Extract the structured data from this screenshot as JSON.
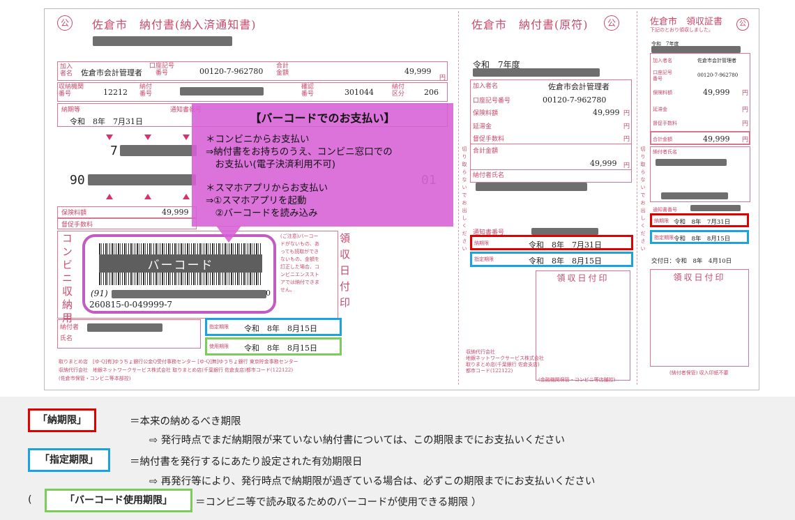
{
  "left_slip": {
    "title": "佐倉市　納付書(納入済通知書)",
    "logo_char": "公",
    "kanyusha_label": "加入者名",
    "kanyusha_name": "佐倉市会計管理者",
    "koza_label": "口座記号番号",
    "koza_no": "00120-7-962780",
    "gokei_label": "合計金額",
    "gokei_amount": "49,999",
    "yen": "円",
    "shuno_label": "収納機関番号",
    "shuno_no": "12212",
    "nofu_no_label": "納付番号",
    "kakunin_label": "確認番号",
    "kakunin_no": "301044",
    "nofu_kubun_label": "納付区分",
    "nofu_kubun": "206",
    "nokigen_label": "納期等",
    "nokigen_value": "令和　8年　7月31日",
    "tsuchisho_label": "通知書番号",
    "barcode_line1_prefix": "7",
    "barcode_line2_prefix": "90",
    "barcode_line2_suffix": "01",
    "hokenryo_label": "保険料額",
    "hokenryo_amount": "49,999",
    "tokusoku_label": "督促手数料",
    "conv_vertical": "コンビニ収納用",
    "barcode_text": "バーコード",
    "barcode_prefix": "(91)",
    "barcode_bottom": "260815-0-049999-7",
    "note_text": "(ご注意)バーコードがないもの、あっても読取ができないもの、金額を訂正した場合、コンビニエンスストアでは納付できません。",
    "ryoshu_vertical": "領収日付印",
    "shitei_label": "指定期限",
    "shitei_value": "令和　8年　8月15日",
    "shiyou_label": "使用期限",
    "shiyou_value": "令和　8年　8月15日",
    "nofusha_label": "納付者氏名",
    "footer1": "取りまとめ店　[ゆ-Q]有]ゆうちょ銀行公金Q受付事務センター [ゆ-Q]無]ゆうちょ銀行 東京貯金事務センター",
    "footer2": "収納代行会社　地銀ネットワークサービス株式会社 取りまとめ店(千葉銀行 佐倉支店)都市コード(122122)",
    "footer3": "(佐倉市保管・コンビニ等本部控)"
  },
  "popup": {
    "heading": "【バーコードでのお支払い】",
    "lines": [
      "＊コンビニからお支払い",
      "⇒納付書をお持ちのうえ、コンビニ窓口での",
      "　お支払い(電子決済利用不可)",
      "＊スマホアプリからお支払い",
      "⇒①スマホアプリを起動",
      "　②バーコードを読み込み"
    ]
  },
  "middle_slip": {
    "title": "佐倉市　納付書(原符)",
    "logo_char": "公",
    "nendo": "令和　7年度",
    "kanyusha_label": "加入者名",
    "kanyusha_name": "佐倉市会計管理者",
    "koza_label": "口座記号番号",
    "koza_no": "00120-7-962780",
    "hokenryo_label": "保険料額",
    "hokenryo_amount": "49,999",
    "entai_label": "延滞金",
    "tokusoku_label": "督促手数料",
    "gokei_label": "合計金額",
    "gokei_amount": "49,999",
    "yen": "円",
    "side_vertical": "切り取らないでお出しください",
    "nofusha_label": "納付者氏名",
    "tsuchisho_label": "通知書番号",
    "nokigen_label": "納期限",
    "nokigen_value": "令和　8年　7月31日",
    "shitei_label": "指定期限",
    "shitei_value": "令和　8年　8月15日",
    "ryoshu_label": "領収日付印",
    "company1": "収納代行会社",
    "company2": "地銀ネットワークサービス株式会社",
    "company3": "取りまとめ店(千葉銀行 佐倉支店)",
    "company4": "都市コード(122122)",
    "bottom_note": "(金融機関保管・コンビニ等店舗控)"
  },
  "right_slip": {
    "title": "佐倉市　領収証書",
    "subtitle": "下記のとおり領収しました。",
    "logo_char": "公",
    "nendo": "令和　7年度",
    "kanyusha_label": "加入者名",
    "kanyusha_name": "佐倉市会計管理者",
    "koza_label": "口座記号番号",
    "koza_no": "00120-7-962780",
    "hokenryo_label": "保険料額",
    "hokenryo_amount": "49,999",
    "entai_label": "延滞金",
    "tokusoku_label": "督促手数料",
    "gokei_label": "合計金額",
    "gokei_amount": "49,999",
    "yen": "円",
    "side_vertical": "切り取らないでお出しください",
    "nofusha_label": "納付者氏名",
    "tsuchisho_label": "通知書番号",
    "nokigen_label": "納期限",
    "nokigen_value": "令和　8年　7月31日",
    "shitei_label": "指定期限",
    "shitei_value": "令和　8年　8月15日",
    "kofu_label": "交付日：令和　8年　4月10日",
    "ryoshu_label": "領収日付印",
    "bottom_note": "(納付者保管) 収入印紙不要"
  },
  "legend": {
    "nokigen": {
      "label": "「納期限」",
      "desc": "＝本来の納めるべき期限",
      "sub": "⇨ 発行時点でまだ納期限が来ていない納付書については、この期限までにお支払いください"
    },
    "shitei": {
      "label": "「指定期限」",
      "desc": "＝納付書を発行するにあたり設定された有効期限日",
      "sub": "⇨ 再発行等により、発行時点で納期限が過ぎている場合は、必ずこの期限までにお支払いください"
    },
    "barcode": {
      "open": "(",
      "label": "「バーコード使用期限」",
      "desc": "＝コンビニ等で読み取るためのバーコードが使用できる期限 ）"
    }
  },
  "colors": {
    "slip_pink": "#d9768f",
    "nokigen_red": "#e00000",
    "shitei_blue": "#1aa3e0",
    "barcode_green": "#7ccc5c",
    "popup_purple": "#d660d6"
  }
}
